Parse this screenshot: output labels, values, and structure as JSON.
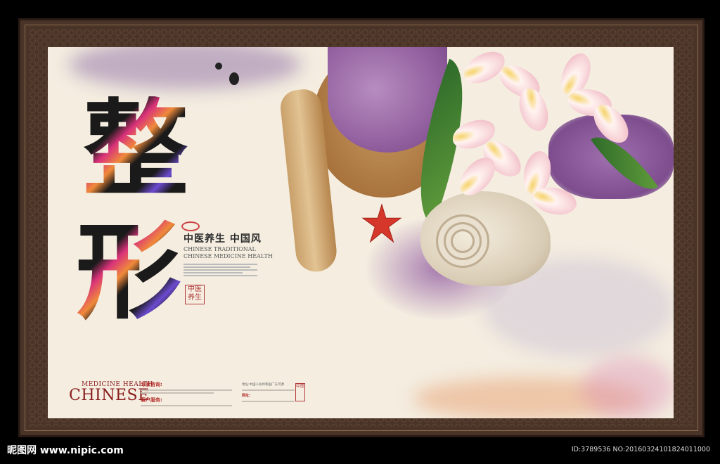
{
  "title": {
    "char1": "整",
    "char2": "形"
  },
  "subtitle": {
    "cn": "中医养生 中国风",
    "en_line1": "CHINESE TRADITIONAL",
    "en_line2": "CHINESE MEDICINE HEALTH",
    "seal": "中医养生"
  },
  "footer": {
    "brand_top": "MEDICINE HEALTH",
    "brand_main": "CHINESE",
    "block1_label1": "专家咨询:",
    "block1_label2": "客户服务:",
    "block2_line1": "地址:中国人民共和国广东河源",
    "block2_label": "网址:",
    "seal": "中医"
  },
  "watermark": {
    "left": "昵图网 www.nipic.com",
    "right": "ID:3789536 NO:20160324101824011000"
  },
  "colors": {
    "frame": "#4a3428",
    "paper": "#f4ede0",
    "accent_red": "#b4302c"
  }
}
